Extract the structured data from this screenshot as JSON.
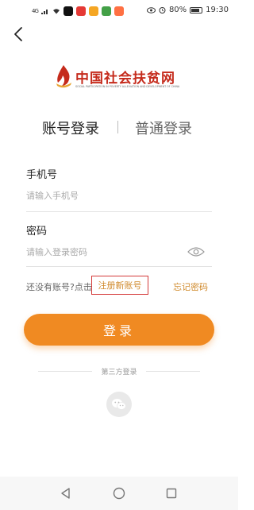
{
  "status_bar": {
    "signal": "4G",
    "battery": "80%",
    "time": "19:30",
    "app_icon_colors": [
      "#111111",
      "#e53935",
      "#f5a623",
      "#43a047",
      "#ff7043"
    ]
  },
  "logo": {
    "title": "中国社会扶贫网",
    "subtitle": "SOCIAL PARTICIPATION IN POVERTY ALLEVIATION AND DEVELOPMENT OF CHINA"
  },
  "tabs": {
    "account_login": "账号登录",
    "normal_login": "普通登录"
  },
  "form": {
    "phone_label": "手机号",
    "phone_placeholder": "请输入手机号",
    "password_label": "密码",
    "password_placeholder": "请输入登录密码"
  },
  "links": {
    "no_account": "还没有账号?点击",
    "register": "注册新账号",
    "forgot": "忘记密码"
  },
  "login_button": "登录",
  "third_party": {
    "label": "第三方登录"
  },
  "colors": {
    "accent": "#f08a22",
    "link": "#d08a2c",
    "brand_red": "#c52b1c",
    "highlight_box": "#d43a3a"
  }
}
